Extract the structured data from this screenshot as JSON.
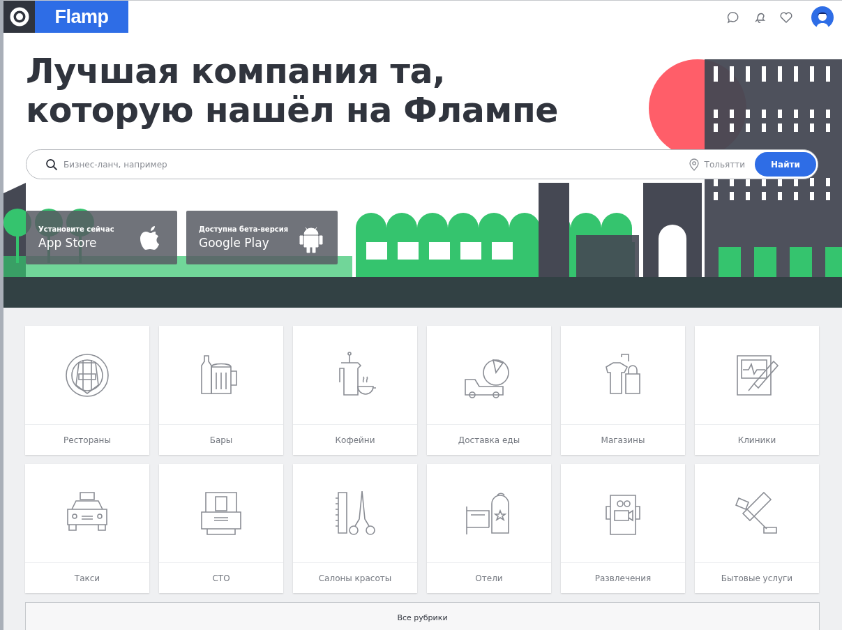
{
  "header": {
    "logo": "Flamp"
  },
  "hero": {
    "title_lines": [
      "Лучшая компания та,",
      "которую нашёл на Флампе"
    ]
  },
  "search": {
    "placeholder": "Бизнес-ланч, например",
    "city": "Тольятти",
    "button": "Найти"
  },
  "app_buttons": [
    {
      "kind": "ios",
      "caption": "Установите сейчас",
      "store": "App Store"
    },
    {
      "kind": "android",
      "caption": "Доступна бета-версия",
      "store": "Google Play"
    }
  ],
  "categories": [
    {
      "label": "Рестораны"
    },
    {
      "label": "Бары"
    },
    {
      "label": "Кофейни"
    },
    {
      "label": "Доставка еды"
    },
    {
      "label": "Магазины"
    },
    {
      "label": "Клиники"
    },
    {
      "label": "Такси"
    },
    {
      "label": "СТО"
    },
    {
      "label": "Салоны красоты"
    },
    {
      "label": "Отели"
    },
    {
      "label": "Развлечения"
    },
    {
      "label": "Бытовые услуги"
    }
  ],
  "all_rubrics": "Все рубрики"
}
